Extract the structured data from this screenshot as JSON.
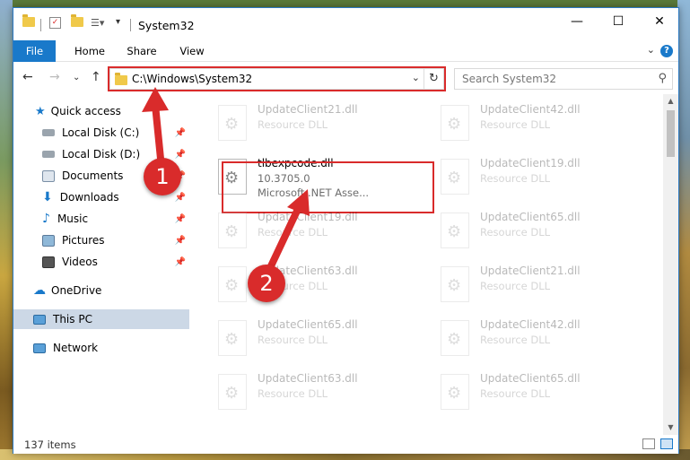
{
  "window": {
    "title": "System32",
    "controls": {
      "minimize": "—",
      "maximize": "☐",
      "close": "✕"
    }
  },
  "ribbon": {
    "tabs": [
      {
        "label": "File"
      },
      {
        "label": "Home"
      },
      {
        "label": "Share"
      },
      {
        "label": "View"
      }
    ],
    "help": "?"
  },
  "address": {
    "path": "C:\\Windows\\System32",
    "search_placeholder": "Search System32"
  },
  "sidebar": {
    "items": [
      {
        "label": "Quick access",
        "icon": "star-icon",
        "pinned": false
      },
      {
        "label": "Local Disk (C:)",
        "icon": "drive-icon",
        "pinned": true
      },
      {
        "label": "Local Disk (D:)",
        "icon": "drive-icon",
        "pinned": true
      },
      {
        "label": "Documents",
        "icon": "documents-icon",
        "pinned": true
      },
      {
        "label": "Downloads",
        "icon": "downloads-icon",
        "pinned": true
      },
      {
        "label": "Music",
        "icon": "music-icon",
        "pinned": true
      },
      {
        "label": "Pictures",
        "icon": "pictures-icon",
        "pinned": true
      },
      {
        "label": "Videos",
        "icon": "videos-icon",
        "pinned": true
      },
      {
        "label": "OneDrive",
        "icon": "onedrive-icon",
        "pinned": false
      },
      {
        "label": "This PC",
        "icon": "computer-icon",
        "pinned": false,
        "selected": true
      },
      {
        "label": "Network",
        "icon": "network-icon",
        "pinned": false
      }
    ]
  },
  "files": {
    "highlighted": {
      "name": "tlbexpcode.dll",
      "version": "10.3705.0",
      "description": "Microsoft .NET Asse..."
    },
    "left_column": [
      {
        "name": "UpdateClient21.dll",
        "type": "Resource DLL"
      },
      {
        "name": "UpdateClient19.dll",
        "type": "Resource DLL"
      },
      {
        "name": "UpdateClient63.dll",
        "type": "Resource DLL"
      },
      {
        "name": "UpdateClient65.dll",
        "type": "Resource DLL"
      },
      {
        "name": "UpdateClient63.dll",
        "type": "Resource DLL"
      }
    ],
    "right_column": [
      {
        "name": "UpdateClient42.dll",
        "type": "Resource DLL"
      },
      {
        "name": "UpdateClient19.dll",
        "type": "Resource DLL"
      },
      {
        "name": "UpdateClient65.dll",
        "type": "Resource DLL"
      },
      {
        "name": "UpdateClient21.dll",
        "type": "Resource DLL"
      },
      {
        "name": "UpdateClient42.dll",
        "type": "Resource DLL"
      },
      {
        "name": "UpdateClient65.dll",
        "type": "Resource DLL"
      }
    ]
  },
  "status": {
    "item_count": "137 items"
  },
  "callouts": {
    "step1": "1",
    "step2": "2"
  },
  "colors": {
    "accent": "#1979ca",
    "highlight": "#d92b2b",
    "selected_bg": "#ccd8e6"
  }
}
